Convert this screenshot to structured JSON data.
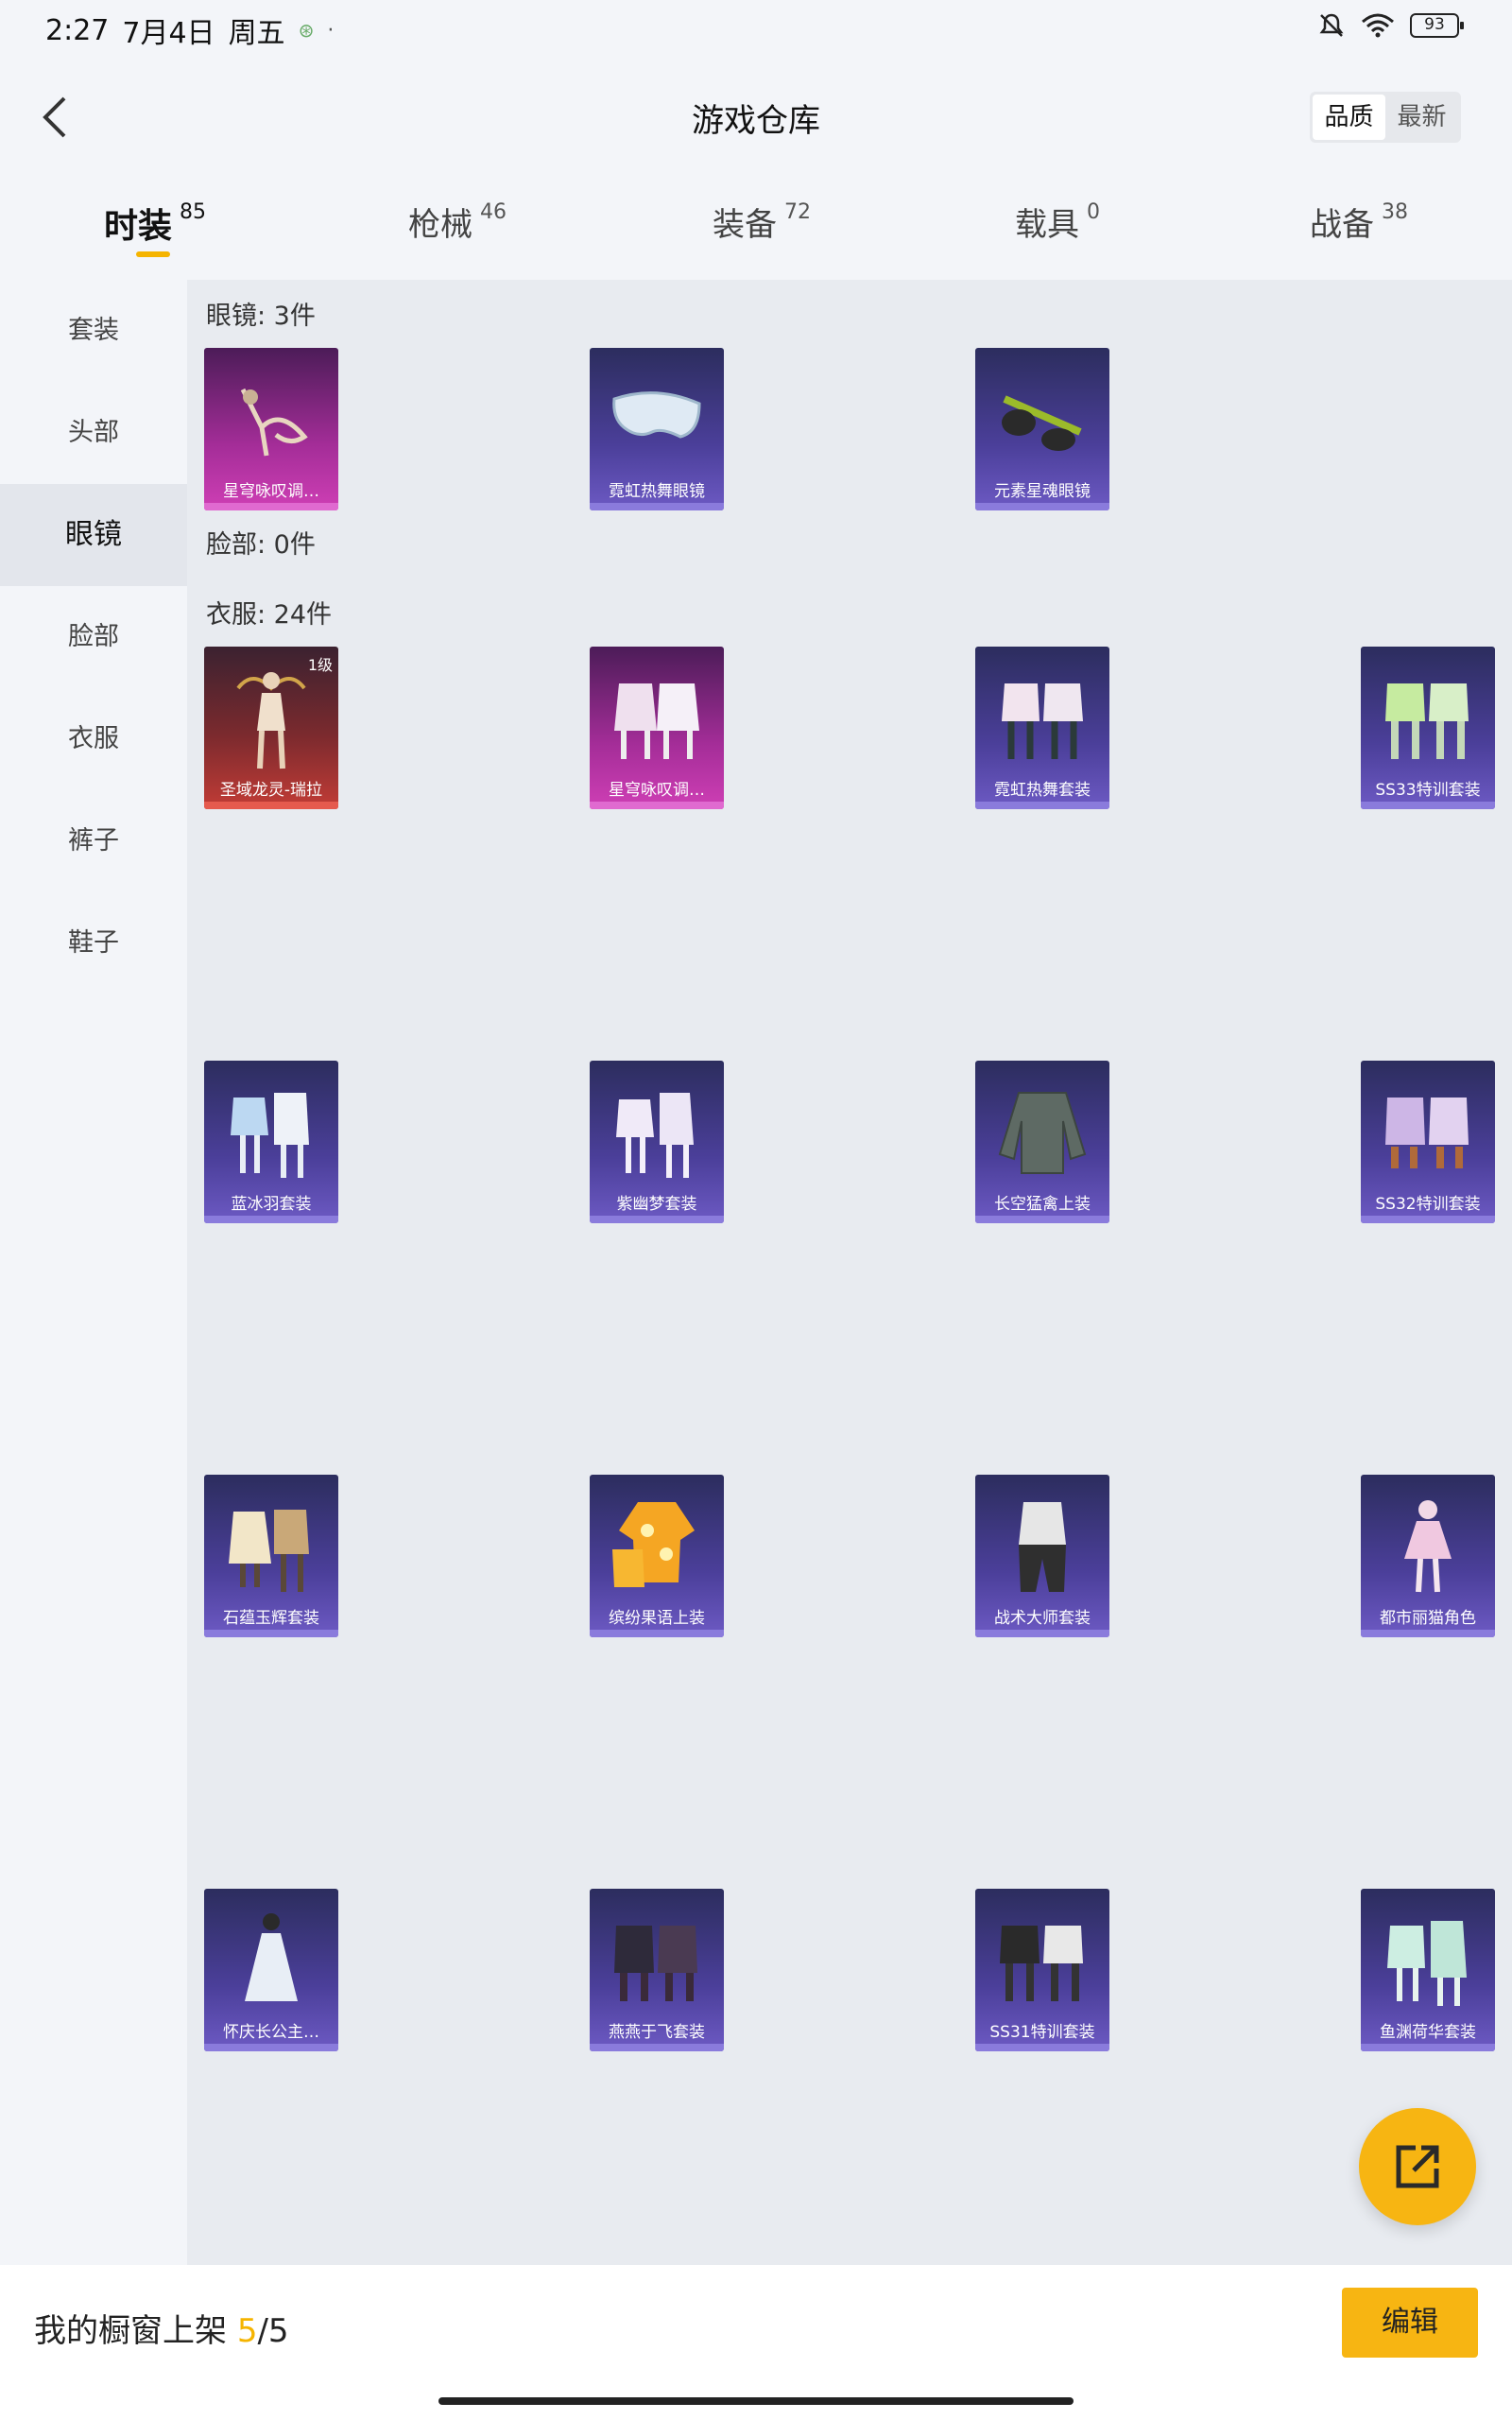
{
  "status": {
    "time": "2:27",
    "date": "7月4日",
    "weekday": "周五",
    "battery": "93"
  },
  "header": {
    "title": "游戏仓库",
    "sort_quality": "品质",
    "sort_latest": "最新"
  },
  "tabs": [
    {
      "label": "时装",
      "count": "85"
    },
    {
      "label": "枪械",
      "count": "46"
    },
    {
      "label": "装备",
      "count": "72"
    },
    {
      "label": "载具",
      "count": "0"
    },
    {
      "label": "战备",
      "count": "38"
    }
  ],
  "sidebar": [
    "套装",
    "头部",
    "眼镜",
    "脸部",
    "衣服",
    "裤子",
    "鞋子"
  ],
  "sections": {
    "glasses": {
      "title": "眼镜: 3件",
      "items": [
        "星穹咏叹调…",
        "霓虹热舞眼镜",
        "元素星魂眼镜"
      ]
    },
    "face": {
      "title": "脸部: 0件"
    },
    "clothes": {
      "title": "衣服: 24件",
      "level_badge": "1级",
      "items": [
        "圣域龙灵-瑞拉",
        "星穹咏叹调…",
        "霓虹热舞套装",
        "SS33特训套装",
        "蓝冰羽套装",
        "紫幽梦套装",
        "长空猛禽上装",
        "SS32特训套装",
        "石蕴玉辉套装",
        "缤纷果语上装",
        "战术大师套装",
        "都市丽猫角色",
        "怀庆长公主…",
        "燕燕于飞套装",
        "SS31特训套装",
        "鱼渊荷华套装"
      ]
    }
  },
  "bottom": {
    "label": "我的橱窗上架 ",
    "current": "5",
    "total": "/5",
    "edit": "编辑"
  },
  "colors": {
    "accent": "#f5b400",
    "rare_blue": "#4b3f9a",
    "epic_pink": "#a42d98",
    "legend_red": "#c23c36"
  }
}
